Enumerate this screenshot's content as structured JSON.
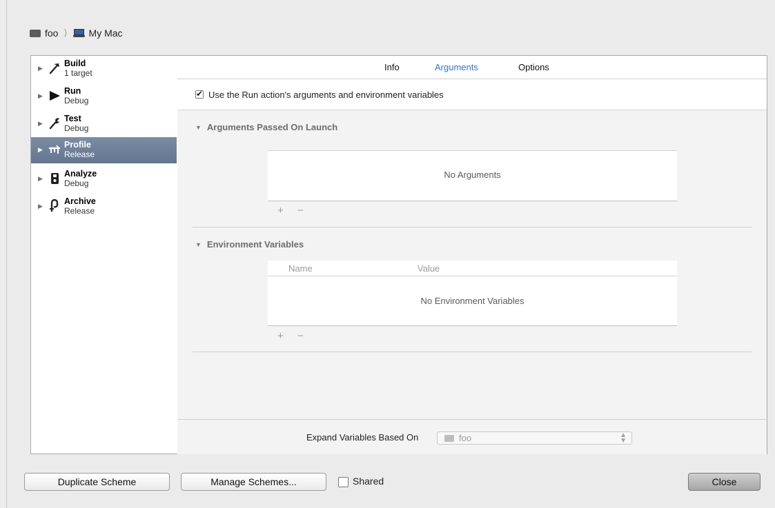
{
  "breadcrumb": {
    "project": "foo",
    "destination": "My Mac"
  },
  "actions": [
    {
      "name": "Build",
      "sub": "1 target",
      "icon": "hammer-icon"
    },
    {
      "name": "Run",
      "sub": "Debug",
      "icon": "play-icon"
    },
    {
      "name": "Test",
      "sub": "Debug",
      "icon": "wrench-icon"
    },
    {
      "name": "Profile",
      "sub": "Release",
      "icon": "instruments-icon",
      "selected": true
    },
    {
      "name": "Analyze",
      "sub": "Debug",
      "icon": "analyze-icon"
    },
    {
      "name": "Archive",
      "sub": "Release",
      "icon": "archive-icon"
    }
  ],
  "tabs": {
    "info": "Info",
    "arguments": "Arguments",
    "options": "Options"
  },
  "use_run_args": {
    "label": "Use the Run action's arguments and environment variables",
    "checked": true
  },
  "arguments": {
    "title": "Arguments Passed On Launch",
    "empty": "No Arguments"
  },
  "env": {
    "title": "Environment Variables",
    "col_name": "Name",
    "col_value": "Value",
    "empty": "No Environment Variables"
  },
  "controls": {
    "add": "+",
    "remove": "−"
  },
  "expand": {
    "label": "Expand Variables Based On",
    "value": "foo"
  },
  "buttons": {
    "duplicate": "Duplicate Scheme",
    "manage": "Manage Schemes...",
    "shared": "Shared",
    "close": "Close"
  },
  "colors": {
    "accent": "#2f73d0",
    "selection": "#6e7f94"
  }
}
